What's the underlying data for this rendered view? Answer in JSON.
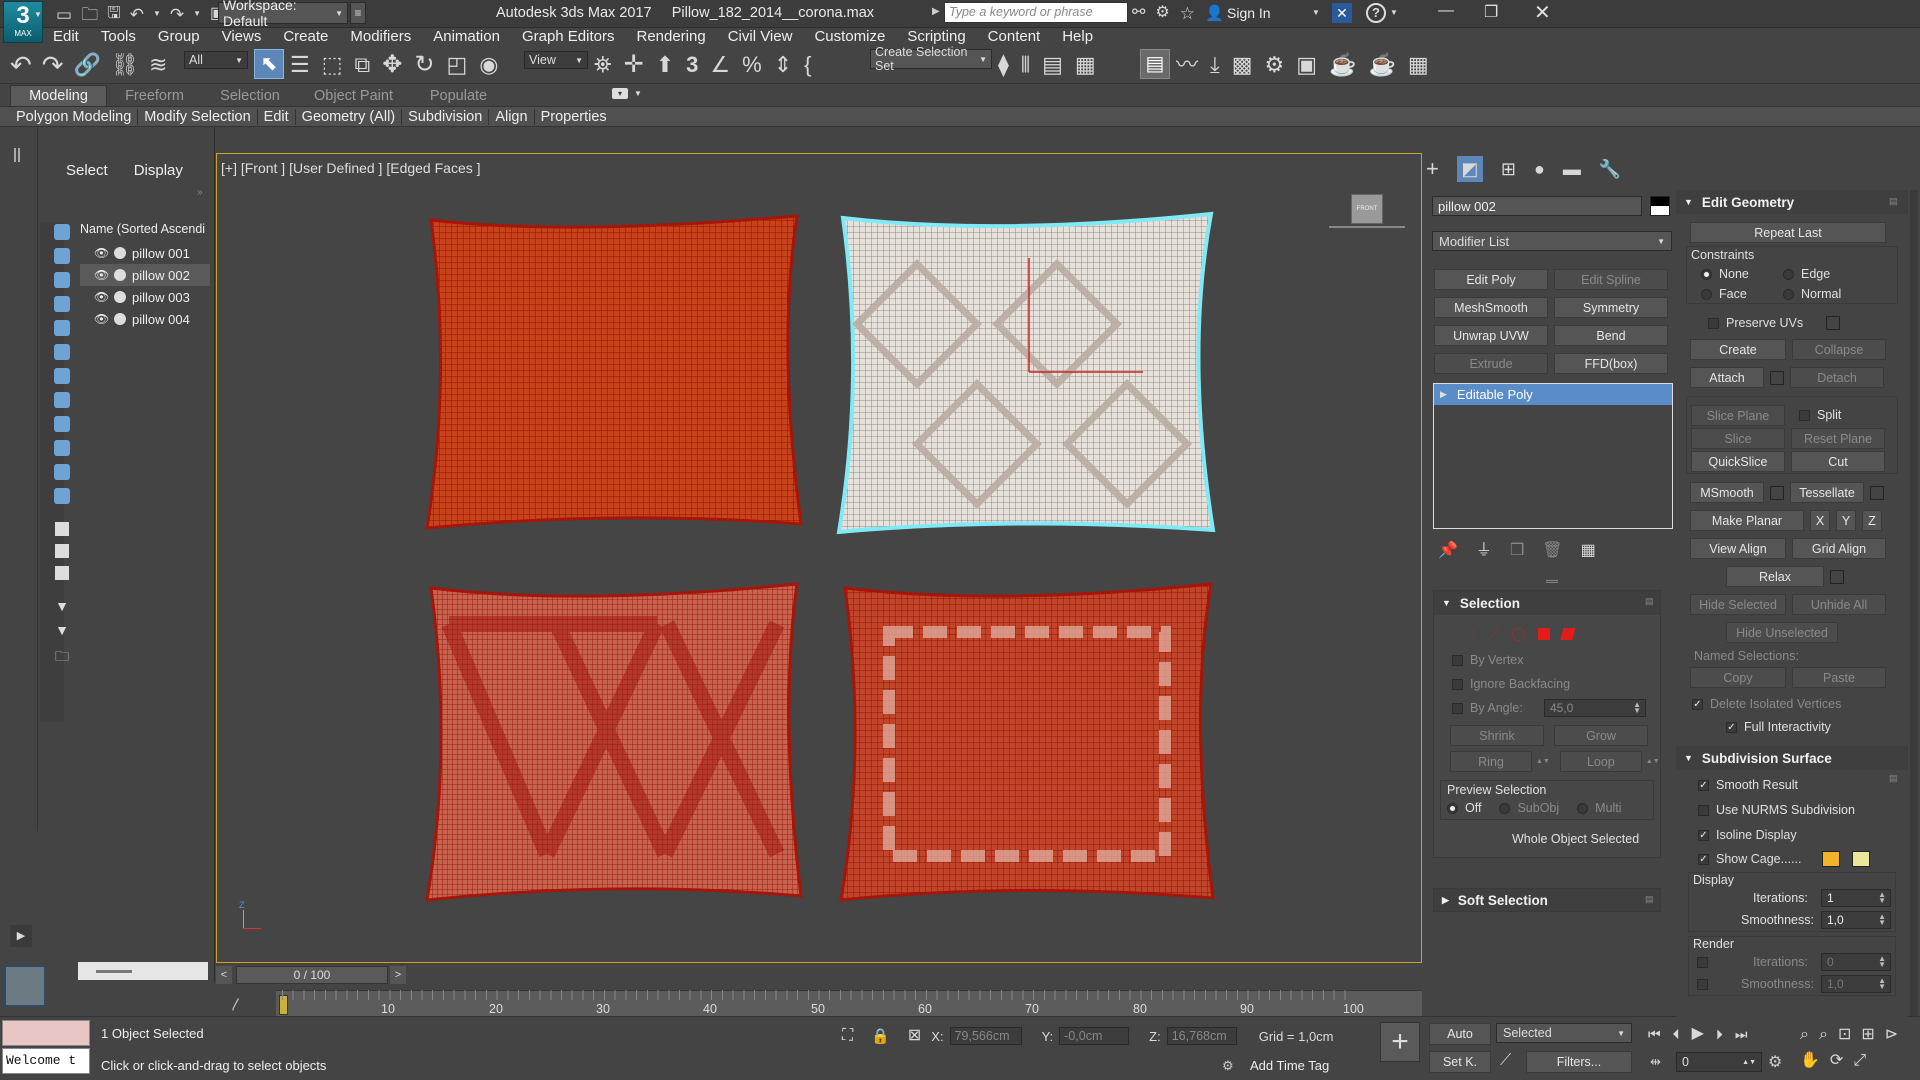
{
  "titlebar": {
    "logo": "3",
    "logo_sub": "MAX",
    "workspace": "Workspace: Default",
    "title": "Autodesk 3ds Max 2017     Pillow_182_2014__corona.max",
    "search_placeholder": "Type a keyword or phrase",
    "sign_in": "Sign In"
  },
  "menu": [
    "Edit",
    "Tools",
    "Group",
    "Views",
    "Create",
    "Modifiers",
    "Animation",
    "Graph Editors",
    "Rendering",
    "Civil View",
    "Customize",
    "Scripting",
    "Content",
    "Help"
  ],
  "toolbar": {
    "filter": "All",
    "ref_coord": "View",
    "selection_set": "Create Selection Set"
  },
  "ribbon": {
    "tabs": [
      "Modeling",
      "Freeform",
      "Selection",
      "Object Paint",
      "Populate"
    ],
    "subtabs": [
      "Polygon Modeling",
      "Modify Selection",
      "Edit",
      "Geometry (All)",
      "Subdivision",
      "Align",
      "Properties"
    ]
  },
  "scene_explorer": {
    "tabs": [
      "Select",
      "Display"
    ],
    "column": "Name (Sorted Ascendi",
    "items": [
      "pillow 001",
      "pillow 002",
      "pillow 003",
      "pillow 004"
    ],
    "selected_index": 1
  },
  "viewport": {
    "label": "[+] [Front ] [User Defined ] [Edged Faces ]",
    "viewcube": "FRONT",
    "axis": "Z",
    "selection_color": "#7fe9f5",
    "wire_color": "#b31b0b"
  },
  "timeline": {
    "frame": "0 / 100",
    "ticks": [
      "10",
      "20",
      "30",
      "40",
      "50",
      "60",
      "70",
      "80",
      "90",
      "100"
    ]
  },
  "status": {
    "objects": "1 Object Selected",
    "prompt": "Click or click-and-drag to select objects",
    "listener": "Welcome t",
    "x_label": "X:",
    "x": "79,566cm",
    "y_label": "Y:",
    "y": "-0,0cm",
    "z_label": "Z:",
    "z": "16,768cm",
    "grid": "Grid = 1,0cm",
    "add_time_tag": "Add Time Tag",
    "auto": "Auto",
    "set_key": "Set K.",
    "selected": "Selected",
    "filters": "Filters...",
    "frame_field": "0"
  },
  "command_panel": {
    "object_name": "pillow 002",
    "modifier_list": "Modifier List",
    "modifier_buttons": [
      {
        "label": "Edit Poly",
        "enabled": true
      },
      {
        "label": "Edit Spline",
        "enabled": false
      },
      {
        "label": "MeshSmooth",
        "enabled": true
      },
      {
        "label": "Symmetry",
        "enabled": true
      },
      {
        "label": "Unwrap UVW",
        "enabled": true
      },
      {
        "label": "Bend",
        "enabled": true
      },
      {
        "label": "Extrude",
        "enabled": false
      },
      {
        "label": "FFD(box)",
        "enabled": true
      }
    ],
    "stack": [
      "Editable Poly"
    ],
    "selection": {
      "title": "Selection",
      "by_vertex": "By Vertex",
      "ignore_backfacing": "Ignore Backfacing",
      "by_angle": "By Angle:",
      "angle": "45,0",
      "shrink": "Shrink",
      "grow": "Grow",
      "ring": "Ring",
      "loop": "Loop",
      "preview": "Preview Selection",
      "off": "Off",
      "subobj": "SubObj",
      "multi": "Multi",
      "status": "Whole Object Selected"
    },
    "soft_selection": "Soft Selection"
  },
  "edit_geometry": {
    "title": "Edit Geometry",
    "repeat_last": "Repeat Last",
    "constraints": "Constraints",
    "none": "None",
    "edge": "Edge",
    "face": "Face",
    "normal": "Normal",
    "preserve_uvs": "Preserve UVs",
    "create": "Create",
    "collapse": "Collapse",
    "attach": "Attach",
    "detach": "Detach",
    "slice_plane": "Slice Plane",
    "split": "Split",
    "slice": "Slice",
    "reset_plane": "Reset Plane",
    "quickslice": "QuickSlice",
    "cut": "Cut",
    "msmooth": "MSmooth",
    "tessellate": "Tessellate",
    "make_planar": "Make Planar",
    "x": "X",
    "y": "Y",
    "z": "Z",
    "view_align": "View Align",
    "grid_align": "Grid Align",
    "relax": "Relax",
    "hide_selected": "Hide Selected",
    "unhide_all": "Unhide All",
    "hide_unselected": "Hide Unselected",
    "named_selections": "Named Selections:",
    "copy": "Copy",
    "paste": "Paste",
    "delete_isolated": "Delete Isolated Vertices",
    "full_interactivity": "Full Interactivity"
  },
  "subdivision": {
    "title": "Subdivision Surface",
    "smooth_result": "Smooth Result",
    "use_nurms": "Use NURMS Subdivision",
    "isoline": "Isoline Display",
    "show_cage": "Show Cage......",
    "cage_color_1": "#f2b32a",
    "cage_color_2": "#e9e59a",
    "display": "Display",
    "iterations": "Iterations:",
    "iterations_value": "1",
    "smoothness": "Smoothness:",
    "smoothness_value": "1,0",
    "render": "Render",
    "render_iterations_value": "0",
    "render_smoothness_value": "1,0"
  }
}
